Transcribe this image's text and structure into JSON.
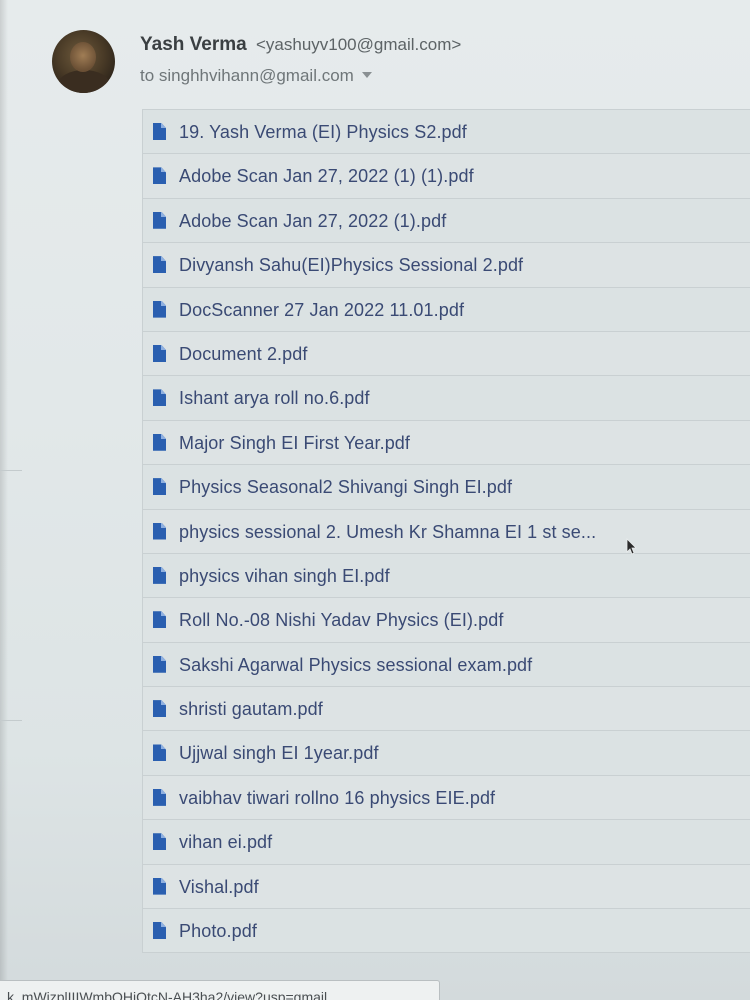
{
  "email": {
    "sender_name": "Yash Verma",
    "sender_email": "<yashuyv100@gmail.com>",
    "to_line": "to singhhvihann@gmail.com"
  },
  "attachments": [
    {
      "name": "19. Yash Verma (EI) Physics S2.pdf",
      "icon": "pdf-file-icon"
    },
    {
      "name": "Adobe Scan Jan 27, 2022 (1) (1).pdf",
      "icon": "pdf-file-icon"
    },
    {
      "name": "Adobe Scan Jan 27, 2022 (1).pdf",
      "icon": "pdf-file-icon"
    },
    {
      "name": "Divyansh Sahu(EI)Physics Sessional 2.pdf",
      "icon": "pdf-file-icon"
    },
    {
      "name": "DocScanner 27 Jan 2022 11.01.pdf",
      "icon": "pdf-file-icon"
    },
    {
      "name": "Document 2.pdf",
      "icon": "pdf-file-icon"
    },
    {
      "name": "Ishant arya roll no.6.pdf",
      "icon": "pdf-file-icon"
    },
    {
      "name": "Major Singh EI First Year.pdf",
      "icon": "pdf-file-icon"
    },
    {
      "name": "Physics Seasonal2 Shivangi Singh EI.pdf",
      "icon": "pdf-file-icon"
    },
    {
      "name": "physics sessional 2. Umesh Kr Shamna EI 1 st se...",
      "icon": "pdf-file-icon"
    },
    {
      "name": "physics vihan singh EI.pdf",
      "icon": "pdf-file-icon"
    },
    {
      "name": "Roll No.-08 Nishi Yadav Physics (EI).pdf",
      "icon": "pdf-file-icon"
    },
    {
      "name": "Sakshi Agarwal Physics sessional exam.pdf",
      "icon": "pdf-file-icon"
    },
    {
      "name": "shristi gautam.pdf",
      "icon": "pdf-file-icon"
    },
    {
      "name": "Ujjwal singh EI 1year.pdf",
      "icon": "pdf-file-icon"
    },
    {
      "name": "vaibhav tiwari rollno 16 physics EIE.pdf",
      "icon": "pdf-file-icon"
    },
    {
      "name": "vihan ei.pdf",
      "icon": "pdf-file-icon"
    },
    {
      "name": "Vishal.pdf",
      "icon": "pdf-file-icon"
    },
    {
      "name": "Photo.pdf",
      "icon": "pdf-file-icon"
    }
  ],
  "status_url": "k_mWizplIIIWmbQHiQtcN-AH3ha2/view?usp=gmail",
  "colors": {
    "file_icon": "#2a5fb0",
    "file_name_text": "#3a4a74",
    "background": "#e2e8e9"
  }
}
